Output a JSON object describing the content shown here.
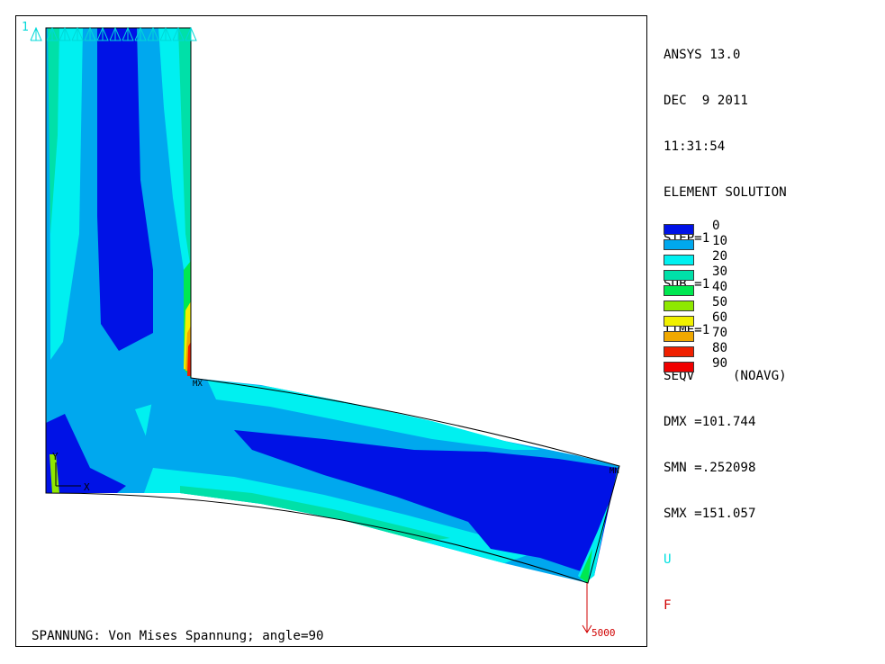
{
  "header": {
    "program": "ANSYS 13.0",
    "date": "DEC  9 2011",
    "time": "11:31:54",
    "solution_type": "ELEMENT SOLUTION",
    "step": "STEP=1",
    "sub": "SUB =1",
    "time_value": "TIME=1",
    "result": "SEQV     (NOAVG)",
    "dmx": "DMX =101.744",
    "smn": "SMN =.252098",
    "smx": "SMX =151.057",
    "symbol_u": "U",
    "symbol_f": "F"
  },
  "colors": {
    "symbol_u": "#00e0e0",
    "symbol_f": "#d00000",
    "force_arrow": "#d00000",
    "constraint": "#00d8d8"
  },
  "legend": [
    {
      "label": "0",
      "color": "#0012e6"
    },
    {
      "label": "10",
      "color": "#00a8ee"
    },
    {
      "label": "20",
      "color": "#00f0f0"
    },
    {
      "label": "30",
      "color": "#00e0a8"
    },
    {
      "label": "40",
      "color": "#00e850"
    },
    {
      "label": "50",
      "color": "#8ee800"
    },
    {
      "label": "60",
      "color": "#f0f000"
    },
    {
      "label": "70",
      "color": "#f0a800"
    },
    {
      "label": "80",
      "color": "#f02000"
    },
    {
      "label": "90",
      "color": "#ffffff"
    }
  ],
  "plot": {
    "window_number": "1",
    "mx_label": "MX",
    "mn_label": "MN",
    "axis_y": "Y",
    "axis_x": "X",
    "force_label": "5000"
  },
  "caption": "SPANNUNG: Von Mises Spannung; angle=90"
}
